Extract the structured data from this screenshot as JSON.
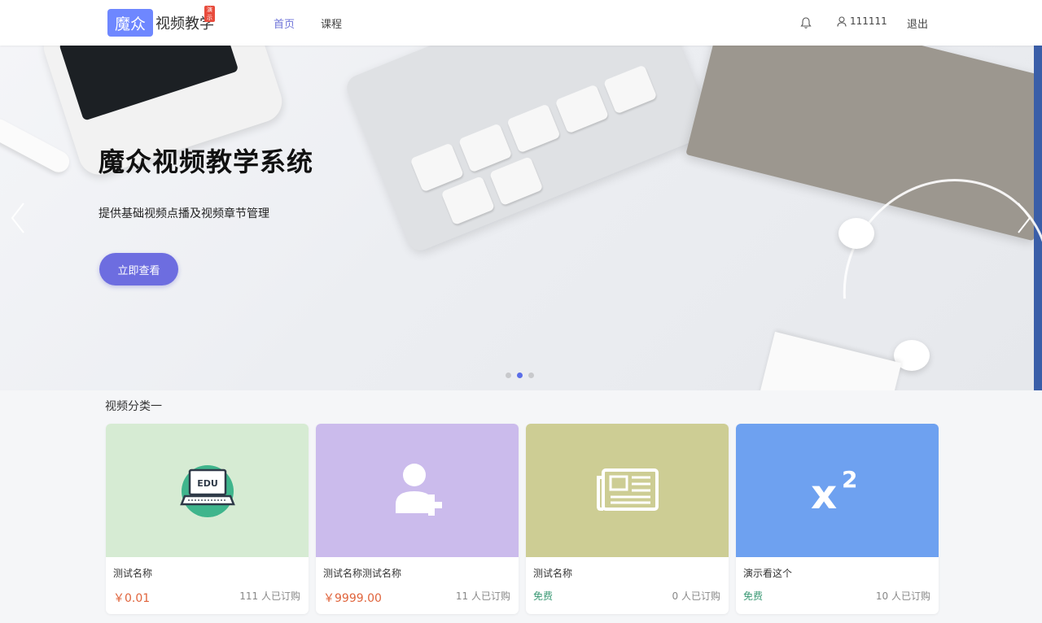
{
  "header": {
    "logo_mark": "魔众",
    "logo_text": "视频教学",
    "logo_badge": "演示",
    "nav": [
      "首页",
      "课程"
    ],
    "username": "111111",
    "logout": "退出",
    "icons": [
      "bell-icon",
      "user-icon"
    ],
    "active_color": "#6e73d8"
  },
  "banner": {
    "title": "魔众视频教学系统",
    "subtitle": "提供基础视频点播及视频章节管理",
    "button": "立即查看",
    "button_color": "#6d6de0",
    "slides": 3,
    "active_slide": 2
  },
  "section": {
    "title": "视频分类一",
    "cards": [
      {
        "name": "测试名称",
        "price": "￥0.01",
        "price_type": "paid",
        "subscribed": "111 人已订购",
        "bg": "#d6ebd3",
        "icon": "edu-laptop-icon"
      },
      {
        "name": "测试名称测试名称",
        "price": "￥9999.00",
        "price_type": "paid",
        "subscribed": "11 人已订购",
        "bg": "#cbbbec",
        "icon": "user-add-icon"
      },
      {
        "name": "测试名称",
        "price": "免费",
        "price_type": "free",
        "subscribed": "0 人已订购",
        "bg": "#cdcd94",
        "icon": "newspaper-icon"
      },
      {
        "name": "演示看这个",
        "price": "免费",
        "price_type": "free",
        "subscribed": "10 人已订购",
        "bg": "#6ea1f0",
        "icon": "superscript-icon"
      }
    ]
  }
}
